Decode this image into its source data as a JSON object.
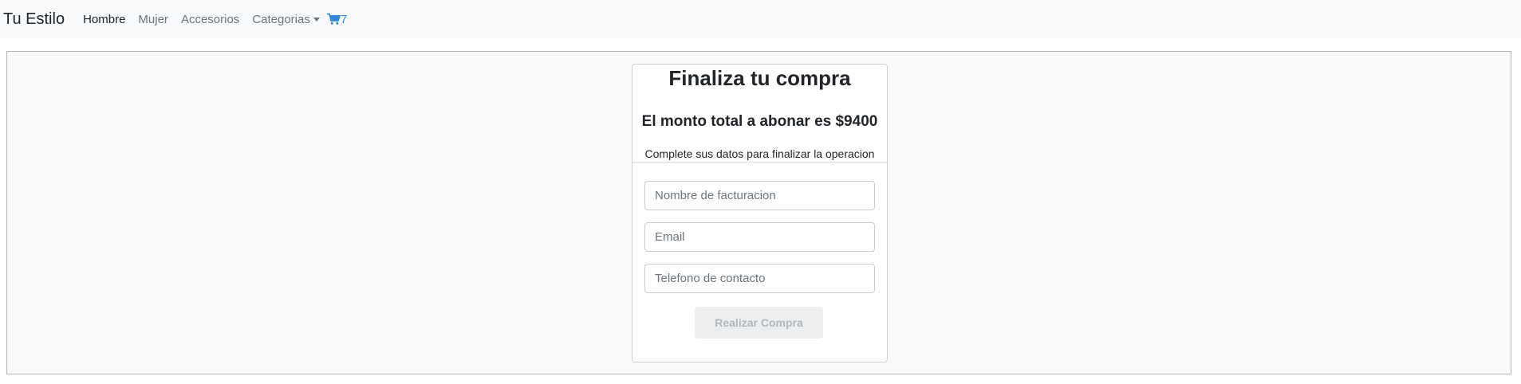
{
  "navbar": {
    "brand": "Tu Estilo",
    "links": [
      {
        "label": "Hombre",
        "active": true
      },
      {
        "label": "Mujer",
        "active": false
      },
      {
        "label": "Accesorios",
        "active": false
      }
    ],
    "dropdown_label": "Categorias",
    "cart_icon": "shopping-cart-icon",
    "cart_count": "7"
  },
  "checkout": {
    "title": "Finaliza tu compra",
    "total_text": "El monto total a abonar es $9400",
    "instructions": "Complete sus datos para finalizar la operacion",
    "fields": {
      "name": {
        "value": "",
        "placeholder": "Nombre de facturacion"
      },
      "email": {
        "value": "",
        "placeholder": "Email"
      },
      "phone": {
        "value": "",
        "placeholder": "Telefono de contacto"
      }
    },
    "submit_label": "Realizar Compra"
  },
  "colors": {
    "navbar_bg": "#f8f9fa",
    "cart_accent": "#2f86d6",
    "disabled_button_bg": "#eceeef"
  }
}
